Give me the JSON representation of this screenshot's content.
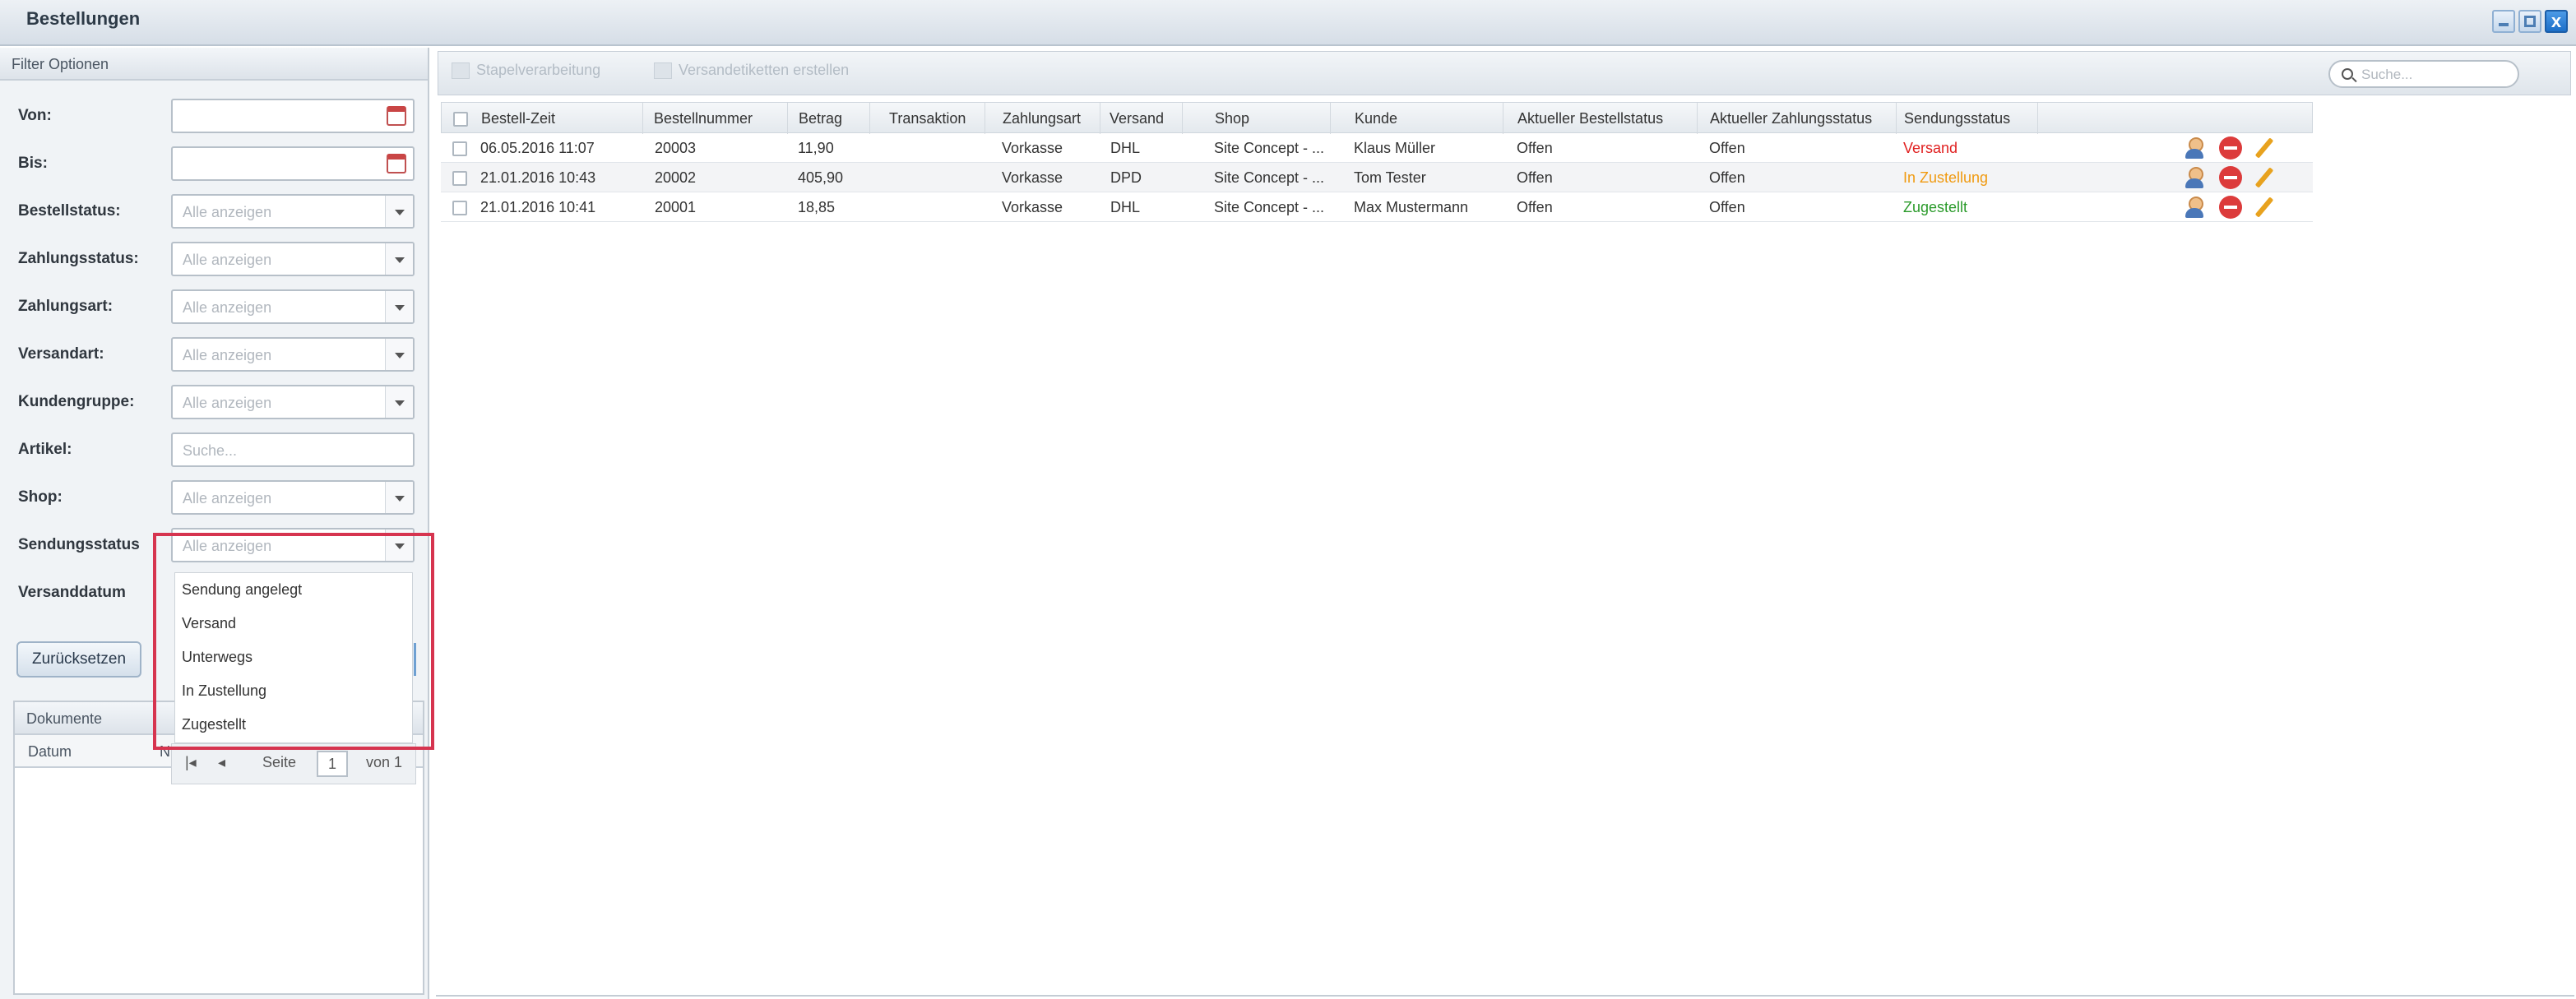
{
  "window": {
    "title": "Bestellungen",
    "buttons": [
      "minimize-icon",
      "maximize-icon",
      "close-icon"
    ],
    "close_glyph": "x"
  },
  "filter": {
    "title": "Filter Optionen",
    "fields": [
      {
        "label": "Von:",
        "value": "",
        "type": "date"
      },
      {
        "label": "Bis:",
        "value": "",
        "type": "date"
      },
      {
        "label": "Bestellstatus:",
        "placeholder": "Alle anzeigen",
        "type": "select"
      },
      {
        "label": "Zahlungsstatus:",
        "placeholder": "Alle anzeigen",
        "type": "select"
      },
      {
        "label": "Zahlungsart:",
        "placeholder": "Alle anzeigen",
        "type": "select"
      },
      {
        "label": "Versandart:",
        "placeholder": "Alle anzeigen",
        "type": "select"
      },
      {
        "label": "Kundengruppe:",
        "placeholder": "Alle anzeigen",
        "type": "select"
      },
      {
        "label": "Artikel:",
        "placeholder": "Suche...",
        "type": "text"
      },
      {
        "label": "Shop:",
        "placeholder": "Alle anzeigen",
        "type": "select"
      },
      {
        "label": "Sendungsstatus",
        "placeholder": "Alle anzeigen",
        "type": "select"
      },
      {
        "label": "Versanddatum",
        "type": "label"
      }
    ],
    "reset_label": "Zurücksetzen",
    "sendungsstatus_options": [
      "Sendung angelegt",
      "Versand",
      "Unterwegs",
      "In Zustellung",
      "Zugestellt"
    ],
    "highlight_color": "#d6344f"
  },
  "documents": {
    "title": "Dokumente",
    "columns": [
      "Datum",
      "N"
    ],
    "pager": {
      "page_label": "Seite",
      "page": "1",
      "of_label": "von 1"
    }
  },
  "toolbar": {
    "batch_label": "Stapelverarbeitung",
    "labels_label": "Versandetiketten erstellen",
    "search_placeholder": "Suche..."
  },
  "grid": {
    "columns": [
      "Bestell-Zeit",
      "Bestellnummer",
      "Betrag",
      "Transaktion",
      "Zahlungsart",
      "Versand",
      "Shop",
      "Kunde",
      "Aktueller Bestellstatus",
      "Aktueller Zahlungsstatus",
      "Sendungsstatus"
    ],
    "rows": [
      {
        "time": "06.05.2016 11:07",
        "number": "20003",
        "amount": "11,90",
        "transaction": "",
        "payment": "Vorkasse",
        "shipping": "DHL",
        "shop": "Site Concept - ...",
        "customer": "Klaus Müller",
        "order_status": "Offen",
        "payment_status": "Offen",
        "shipment_status": "Versand",
        "status_color": "#e02020"
      },
      {
        "time": "21.01.2016 10:43",
        "number": "20002",
        "amount": "405,90",
        "transaction": "",
        "payment": "Vorkasse",
        "shipping": "DPD",
        "shop": "Site Concept - ...",
        "customer": "Tom Tester",
        "order_status": "Offen",
        "payment_status": "Offen",
        "shipment_status": "In Zustellung",
        "status_color": "#f09a10"
      },
      {
        "time": "21.01.2016 10:41",
        "number": "20001",
        "amount": "18,85",
        "transaction": "",
        "payment": "Vorkasse",
        "shipping": "DHL",
        "shop": "Site Concept - ...",
        "customer": "Max Mustermann",
        "order_status": "Offen",
        "payment_status": "Offen",
        "shipment_status": "Zugestellt",
        "status_color": "#2a9a2a"
      }
    ],
    "row_actions": [
      "user-icon",
      "delete-icon",
      "edit-icon"
    ]
  }
}
